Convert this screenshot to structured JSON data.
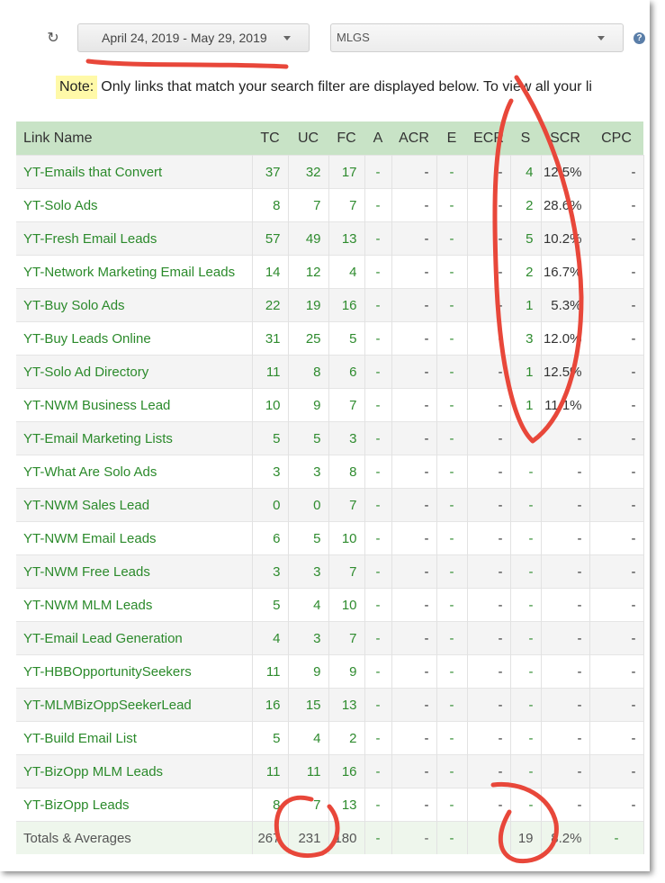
{
  "toolbar": {
    "date_range": "April 24, 2019 - May 29, 2019",
    "search_filter": "MLGS",
    "refresh_icon": "refresh-icon",
    "help_icon": "help-icon",
    "help_glyph": "?"
  },
  "note": {
    "label": "Note:",
    "text": "Only links that match your search filter are displayed below. To view all your li"
  },
  "table": {
    "columns": [
      "Link Name",
      "TC",
      "UC",
      "FC",
      "A",
      "ACR",
      "E",
      "ECR",
      "S",
      "SCR",
      "CPC"
    ],
    "rows": [
      [
        "YT-Emails that Convert",
        "37",
        "32",
        "17",
        "-",
        "-",
        "-",
        "-",
        "4",
        "12.5%",
        "-"
      ],
      [
        "YT-Solo Ads",
        "8",
        "7",
        "7",
        "-",
        "-",
        "-",
        "-",
        "2",
        "28.6%",
        "-"
      ],
      [
        "YT-Fresh Email Leads",
        "57",
        "49",
        "13",
        "-",
        "-",
        "-",
        "-",
        "5",
        "10.2%",
        "-"
      ],
      [
        "YT-Network Marketing Email Leads",
        "14",
        "12",
        "4",
        "-",
        "-",
        "-",
        "-",
        "2",
        "16.7%",
        "-"
      ],
      [
        "YT-Buy Solo Ads",
        "22",
        "19",
        "16",
        "-",
        "-",
        "-",
        "-",
        "1",
        "5.3%",
        "-"
      ],
      [
        "YT-Buy Leads Online",
        "31",
        "25",
        "5",
        "-",
        "-",
        "-",
        "-",
        "3",
        "12.0%",
        "-"
      ],
      [
        "YT-Solo Ad Directory",
        "11",
        "8",
        "6",
        "-",
        "-",
        "-",
        "-",
        "1",
        "12.5%",
        "-"
      ],
      [
        "YT-NWM Business Lead",
        "10",
        "9",
        "7",
        "-",
        "-",
        "-",
        "-",
        "1",
        "11.1%",
        "-"
      ],
      [
        "YT-Email Marketing Lists",
        "5",
        "5",
        "3",
        "-",
        "-",
        "-",
        "-",
        "-",
        "-",
        "-"
      ],
      [
        "YT-What Are Solo Ads",
        "3",
        "3",
        "8",
        "-",
        "-",
        "-",
        "-",
        "-",
        "-",
        "-"
      ],
      [
        "YT-NWM Sales Lead",
        "0",
        "0",
        "7",
        "-",
        "-",
        "-",
        "-",
        "-",
        "-",
        "-"
      ],
      [
        "YT-NWM Email Leads",
        "6",
        "5",
        "10",
        "-",
        "-",
        "-",
        "-",
        "-",
        "-",
        "-"
      ],
      [
        "YT-NWM Free Leads",
        "3",
        "3",
        "7",
        "-",
        "-",
        "-",
        "-",
        "-",
        "-",
        "-"
      ],
      [
        "YT-NWM MLM Leads",
        "5",
        "4",
        "10",
        "-",
        "-",
        "-",
        "-",
        "-",
        "-",
        "-"
      ],
      [
        "YT-Email Lead Generation",
        "4",
        "3",
        "7",
        "-",
        "-",
        "-",
        "-",
        "-",
        "-",
        "-"
      ],
      [
        "YT-HBBOpportunitySeekers",
        "11",
        "9",
        "9",
        "-",
        "-",
        "-",
        "-",
        "-",
        "-",
        "-"
      ],
      [
        "YT-MLMBizOppSeekerLead",
        "16",
        "15",
        "13",
        "-",
        "-",
        "-",
        "-",
        "-",
        "-",
        "-"
      ],
      [
        "YT-Build Email List",
        "5",
        "4",
        "2",
        "-",
        "-",
        "-",
        "-",
        "-",
        "-",
        "-"
      ],
      [
        "YT-BizOpp MLM Leads",
        "11",
        "11",
        "16",
        "-",
        "-",
        "-",
        "-",
        "-",
        "-",
        "-"
      ],
      [
        "YT-BizOpp Leads",
        "8",
        "7",
        "13",
        "-",
        "-",
        "-",
        "-",
        "-",
        "-",
        "-"
      ]
    ],
    "totals": [
      "Totals & Averages",
      "267",
      "231",
      "180",
      "-",
      "-",
      "-",
      "-",
      "19",
      "8.2%",
      "-"
    ]
  },
  "colors": {
    "header_bg": "#c8e3c6",
    "link_green": "#2b8a2b",
    "note_highlight": "#fff9a8",
    "annotation_red": "#e8473a"
  }
}
